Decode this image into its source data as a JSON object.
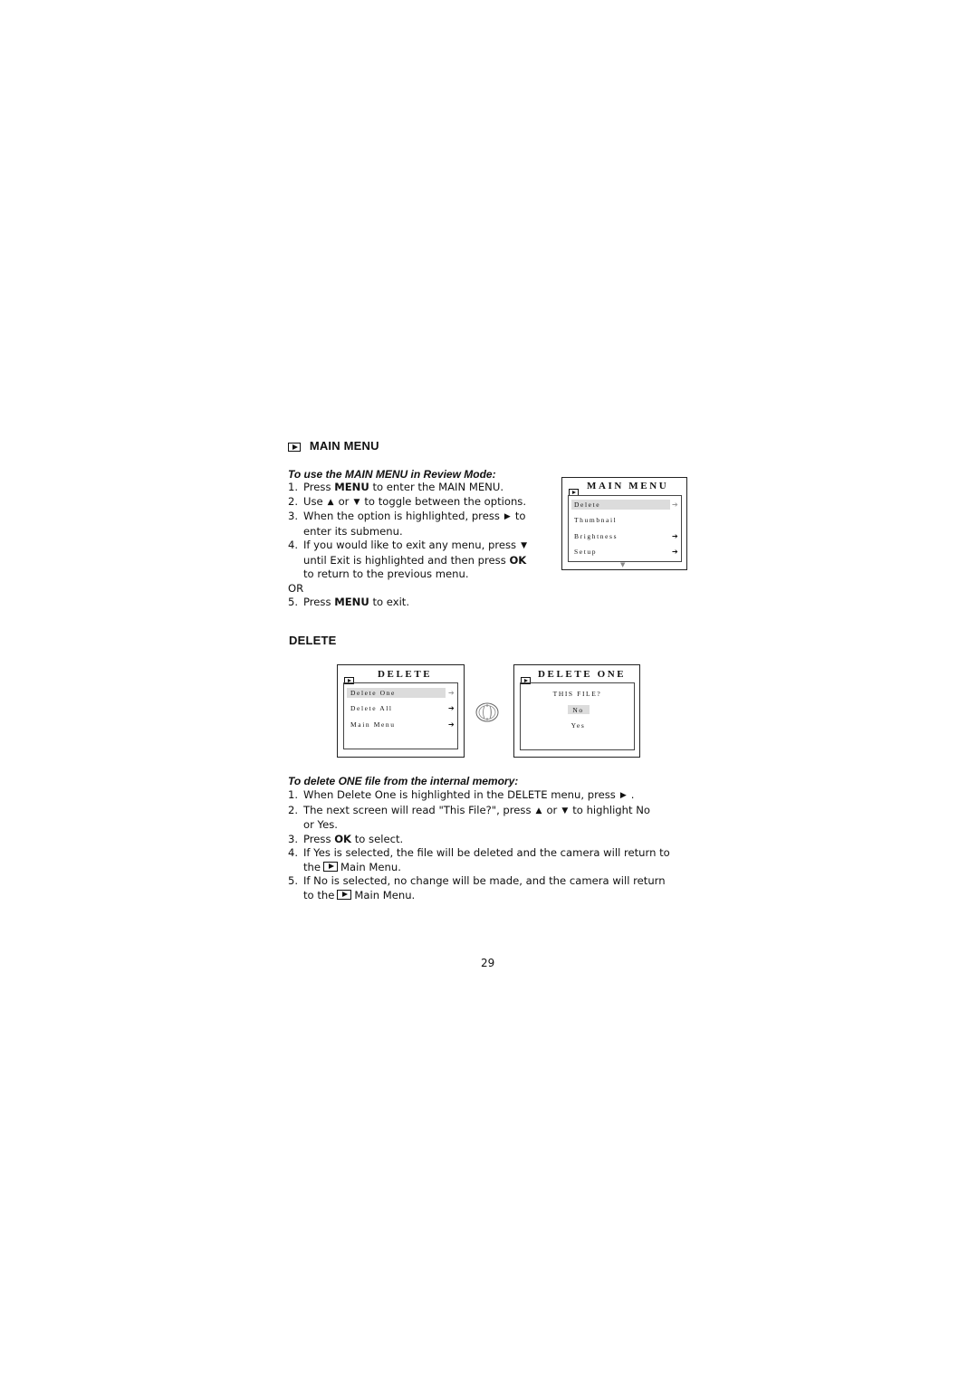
{
  "main_menu_section": {
    "heading": "MAIN MENU",
    "subheading": "To use the MAIN MENU in Review Mode:",
    "steps": [
      {
        "num": "1.",
        "pre": "Press ",
        "bold": "MENU",
        "post": " to enter the MAIN MENU."
      },
      {
        "num": "2.",
        "pre": "Use",
        "sym1": "▲",
        "mid": "or",
        "sym2": "▼",
        "post": "to toggle between the options."
      },
      {
        "num": "3.",
        "pre": "When the option is highlighted, press",
        "sym": "▶",
        "post": "to",
        "line2": "enter its submenu."
      },
      {
        "num": "4.",
        "pre": "If you would like to exit any menu, press",
        "sym": "▼",
        "line2_pre": "until Exit is highlighted and then press ",
        "line2_bold": "OK",
        "line3": "to return to the previous menu."
      },
      {
        "num": "5.",
        "pre": "Press ",
        "bold": "MENU",
        "post": " to exit."
      }
    ],
    "or_label": "OR"
  },
  "main_menu_screen": {
    "title": "MAIN MENU",
    "items": [
      {
        "label": "Delete",
        "arrow": "➔",
        "highlighted": true
      },
      {
        "label": "Thumbnail",
        "arrow": "",
        "highlighted": false
      },
      {
        "label": "Brightness",
        "arrow": "➔",
        "highlighted": false
      },
      {
        "label": "Setup",
        "arrow": "➔",
        "highlighted": false
      }
    ],
    "scroll_indicator": "▼"
  },
  "delete_section": {
    "heading": "DELETE"
  },
  "delete_screen": {
    "title": "DELETE",
    "items": [
      {
        "label": "Delete One",
        "arrow": "➔",
        "highlighted": true
      },
      {
        "label": "Delete All",
        "arrow": "➔",
        "highlighted": false
      },
      {
        "label": "Main Menu",
        "arrow": "➔",
        "highlighted": false
      }
    ]
  },
  "delete_one_screen": {
    "title": "DELETE ONE",
    "prompt": "THIS FILE?",
    "options": [
      {
        "label": "No",
        "highlighted": true
      },
      {
        "label": "Yes",
        "highlighted": false
      }
    ]
  },
  "delete_one_section": {
    "subheading": "To delete ONE file from the internal memory:",
    "steps": [
      {
        "num": "1.",
        "pre": "When Delete One is highlighted in the DELETE menu, press",
        "sym": "▶",
        "post": "."
      },
      {
        "num": "2.",
        "pre": "The next screen will read \"This File?\", press",
        "sym1": "▲",
        "mid": "or",
        "sym2": "▼",
        "post": "to highlight No",
        "line2": "or Yes."
      },
      {
        "num": "3.",
        "pre": "Press ",
        "bold": "OK",
        "post": " to select."
      },
      {
        "num": "4.",
        "pre": "If Yes is selected, the file will be deleted and the camera will return to",
        "line2_pre": "the",
        "line2_post": "Main Menu."
      },
      {
        "num": "5.",
        "pre": "If No is selected, no change will be made, and the camera will return",
        "line2_pre": "to the",
        "line2_post": "Main Menu."
      }
    ]
  },
  "page_number": "29"
}
